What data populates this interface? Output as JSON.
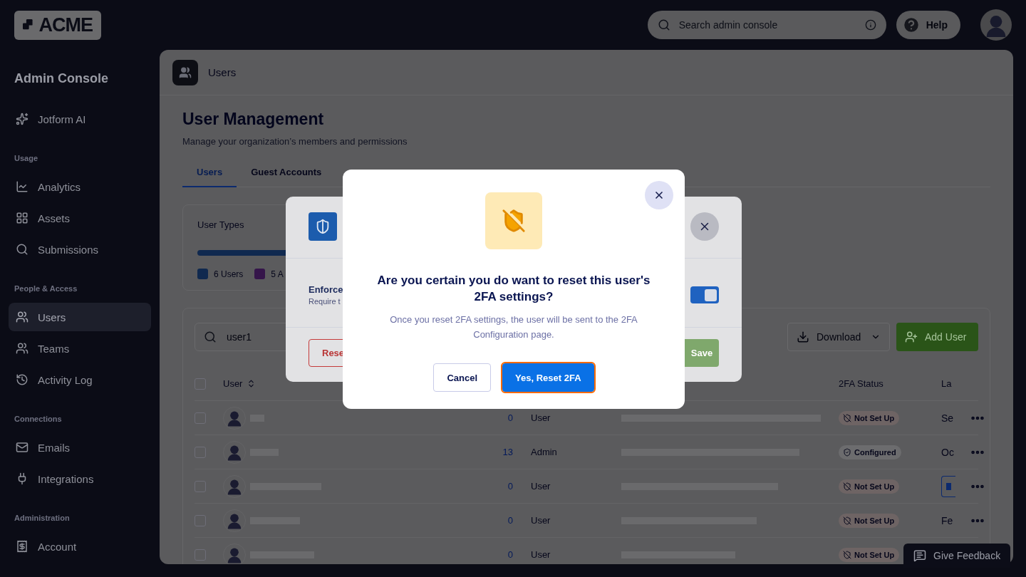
{
  "topbar": {
    "logo": "ACME",
    "search": {
      "placeholder": "Search admin console"
    },
    "help": "Help"
  },
  "sidebar": {
    "title": "Admin Console",
    "sections": [
      {
        "items": [
          {
            "label": "Jotform AI",
            "selected": false
          }
        ]
      },
      {
        "label": "Usage",
        "items": [
          {
            "label": "Analytics",
            "selected": false
          },
          {
            "label": "Assets",
            "selected": false
          },
          {
            "label": "Submissions",
            "selected": false
          }
        ]
      },
      {
        "label": "People & Access",
        "items": [
          {
            "label": "Users",
            "selected": true
          },
          {
            "label": "Teams",
            "selected": false
          },
          {
            "label": "Activity Log",
            "selected": false
          }
        ]
      },
      {
        "label": "Connections",
        "items": [
          {
            "label": "Emails",
            "selected": false
          },
          {
            "label": "Integrations",
            "selected": false
          }
        ]
      },
      {
        "label": "Administration",
        "items": [
          {
            "label": "Account",
            "selected": false
          }
        ]
      }
    ]
  },
  "page": {
    "breadcrumb": "Users",
    "title": "User Management",
    "subtitle": "Manage your organization’s members and permissions",
    "tabs": [
      {
        "label": "Users",
        "selected": true
      },
      {
        "label": "Guest Accounts",
        "selected": false
      }
    ],
    "user_types": {
      "title": "User Types",
      "legend": [
        {
          "label": "6 Users",
          "color": "#10294f"
        },
        {
          "label": "5 A",
          "color": "#35154a"
        }
      ]
    },
    "toolbar": {
      "search": {
        "value": "user1"
      },
      "download": "Download",
      "add_user": "Add User"
    },
    "table": {
      "columns": [
        "User",
        "2FA Status",
        "La"
      ],
      "all_checked": false,
      "rows": [
        {
          "checked": false,
          "count": "0",
          "role": "User",
          "status": {
            "kind": "not_set",
            "label": "Not Set Up"
          },
          "last": {
            "kind": "text",
            "text": "Se"
          },
          "menu": true
        },
        {
          "checked": false,
          "count": "13",
          "role": "Admin",
          "status": {
            "kind": "configured",
            "label": "Configured"
          },
          "last": {
            "kind": "text",
            "text": "Oc"
          },
          "menu": true
        },
        {
          "checked": false,
          "count": "0",
          "role": "User",
          "status": {
            "kind": "not_set",
            "label": "Not Set Up"
          },
          "last": {
            "kind": "chip"
          },
          "menu": true
        },
        {
          "checked": false,
          "count": "0",
          "role": "User",
          "status": {
            "kind": "not_set",
            "label": "Not Set Up"
          },
          "last": {
            "kind": "text",
            "text": "Fe"
          },
          "menu": true
        },
        {
          "checked": false,
          "count": "0",
          "role": "User",
          "status": {
            "kind": "not_set",
            "label": "Not Set Up"
          }
        }
      ]
    }
  },
  "policy_modal": {
    "enforce": "Enforce",
    "require": "Require t",
    "toggle": {
      "on": true
    },
    "reset": "Rese",
    "save": "Save"
  },
  "dialog": {
    "title": "Are you certain you do want to reset this user's 2FA settings?",
    "message": "Once you reset 2FA settings, the user will be sent to the 2FA Configuration page.",
    "buttons": [
      {
        "label": "Cancel",
        "kind": "secondary",
        "focused": false
      },
      {
        "label": "Yes, Reset 2FA",
        "kind": "primary",
        "focused": true
      }
    ]
  },
  "feedback": "Give Feedback"
}
